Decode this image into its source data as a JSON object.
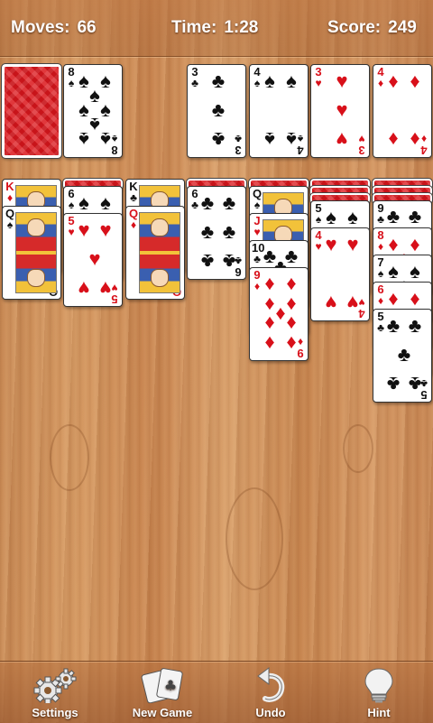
{
  "header": {
    "moves_label": "Moves:",
    "moves_value": "66",
    "time_label": "Time:",
    "time_value": "1:28",
    "score_label": "Score:",
    "score_value": "249"
  },
  "stock": {
    "state": "face-down"
  },
  "waste": [
    {
      "rank": "8",
      "suit": "♠",
      "color": "black"
    }
  ],
  "foundations": [
    {
      "rank": "3",
      "suit": "♣",
      "color": "black"
    },
    {
      "rank": "4",
      "suit": "♠",
      "color": "black"
    },
    {
      "rank": "3",
      "suit": "♥",
      "color": "red"
    },
    {
      "rank": "4",
      "suit": "♦",
      "color": "red"
    }
  ],
  "tableau": [
    [
      {
        "rank": "K",
        "suit": "♦",
        "color": "red",
        "face": true
      },
      {
        "rank": "Q",
        "suit": "♠",
        "color": "black",
        "face": true
      }
    ],
    [
      {
        "rank": "6",
        "suit": "♠",
        "color": "black"
      },
      {
        "rank": "5",
        "suit": "♥",
        "color": "red"
      }
    ],
    [
      {
        "rank": "K",
        "suit": "♣",
        "color": "black",
        "face": true
      },
      {
        "rank": "Q",
        "suit": "♦",
        "color": "red",
        "face": true
      }
    ],
    [
      {
        "rank": "6",
        "suit": "♣",
        "color": "black"
      }
    ],
    [
      {
        "rank": "Q",
        "suit": "♠",
        "color": "black",
        "face": true
      },
      {
        "rank": "J",
        "suit": "♥",
        "color": "red",
        "face": true
      },
      {
        "rank": "10",
        "suit": "♣",
        "color": "black"
      },
      {
        "rank": "9",
        "suit": "♦",
        "color": "red"
      }
    ],
    [
      {
        "rank": "5",
        "suit": "♠",
        "color": "black"
      },
      {
        "rank": "4",
        "suit": "♥",
        "color": "red"
      }
    ],
    [
      {
        "rank": "9",
        "suit": "♣",
        "color": "black"
      },
      {
        "rank": "8",
        "suit": "♦",
        "color": "red"
      },
      {
        "rank": "7",
        "suit": "♠",
        "color": "black"
      },
      {
        "rank": "6",
        "suit": "♦",
        "color": "red"
      },
      {
        "rank": "5",
        "suit": "♣",
        "color": "black"
      }
    ]
  ],
  "toolbar": {
    "settings_label": "Settings",
    "new_game_label": "New Game",
    "undo_label": "Undo",
    "hint_label": "Hint"
  },
  "colors": {
    "red_suit": "#d8101a",
    "black_suit": "#111111",
    "card_back": "#c8141a"
  }
}
